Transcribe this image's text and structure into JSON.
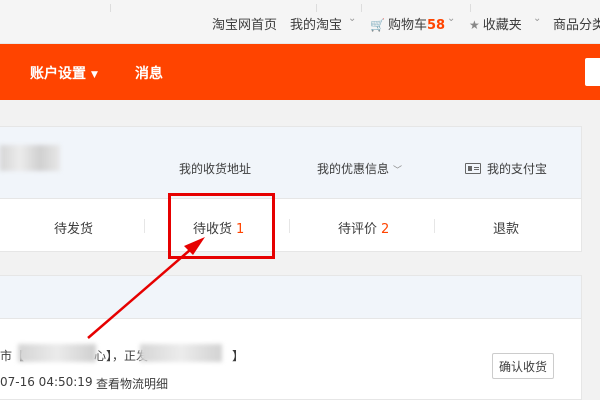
{
  "topbar": {
    "home": "淘宝网首页",
    "my_taobao": "我的淘宝",
    "cart_label": "购物车",
    "cart_count": "58",
    "favorites": "收藏夹",
    "categories": "商品分类"
  },
  "nav": {
    "account_settings": "账户设置",
    "messages": "消息"
  },
  "info": {
    "address": "我的收货地址",
    "coupons": "我的优惠信息",
    "alipay": "我的支付宝"
  },
  "tabs": [
    {
      "label": "待发货",
      "count": ""
    },
    {
      "label": "待收货",
      "count": "1"
    },
    {
      "label": "待评价",
      "count": "2"
    },
    {
      "label": "退款",
      "count": ""
    }
  ],
  "order": {
    "text_part1": "市【",
    "text_part2": "心】，正发",
    "text_part3": "】",
    "time": "07-16 04:50:19",
    "logistics_link": "查看物流明细",
    "confirm_button": "确认收货"
  },
  "colors": {
    "brand_orange": "#ff4400",
    "annotation_red": "#e60000"
  }
}
